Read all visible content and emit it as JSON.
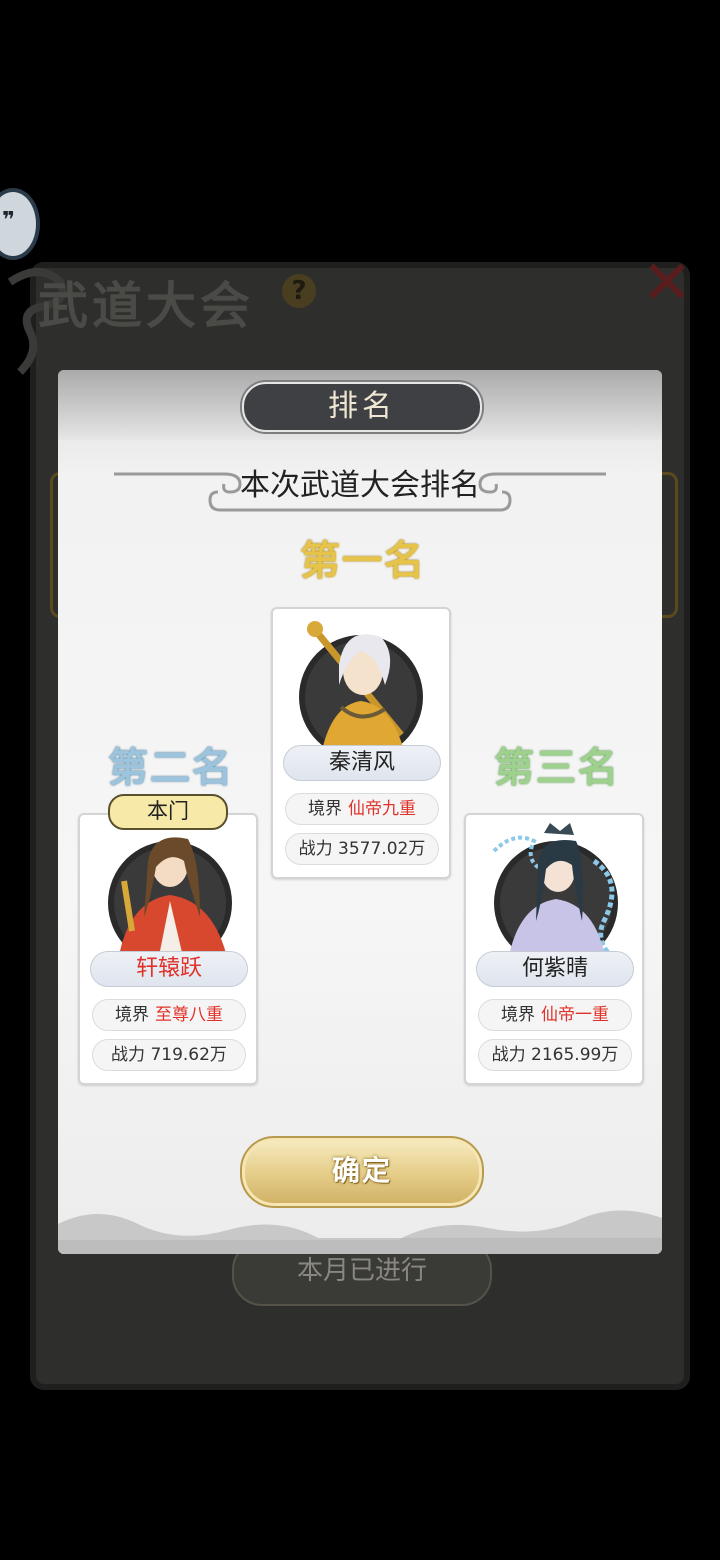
{
  "background": {
    "title": "武道大会",
    "help_icon": "?",
    "close_icon": "✕",
    "bottom_button": "本月已进行"
  },
  "dialog": {
    "tab_title": "排名",
    "subtitle": "本次武道大会排名",
    "ranks": {
      "first": "第一名",
      "second": "第二名",
      "third": "第三名"
    },
    "players": [
      {
        "name": "秦清风",
        "realm_label": "境界",
        "realm": "仙帝九重",
        "power_label": "战力",
        "power": "3577.02万",
        "name_color": "#222222"
      },
      {
        "name": "轩辕跃",
        "realm_label": "境界",
        "realm": "至尊八重",
        "power_label": "战力",
        "power": "719.62万",
        "name_color": "#e0322a",
        "badge": "本门"
      },
      {
        "name": "何紫晴",
        "realm_label": "境界",
        "realm": "仙帝一重",
        "power_label": "战力",
        "power": "2165.99万",
        "name_color": "#222222"
      }
    ],
    "confirm_label": "确定"
  }
}
